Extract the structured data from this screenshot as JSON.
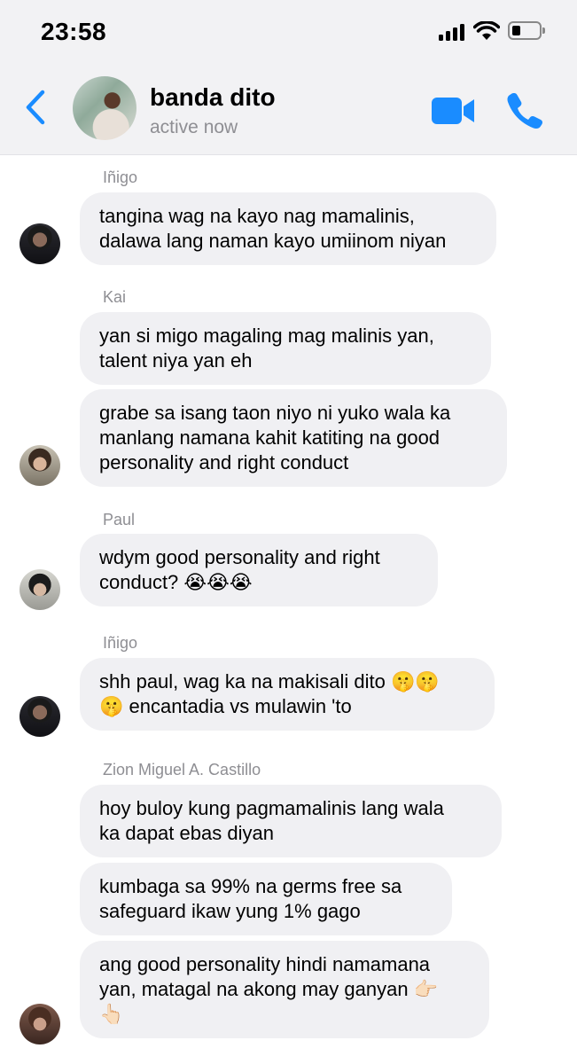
{
  "status_bar": {
    "time": "23:58"
  },
  "header": {
    "title": "banda dito",
    "status": "active now"
  },
  "messages": [
    {
      "sender": "Iñigo",
      "bubbles": [
        "tangina wag na kayo nag mamalinis,\ndalawa lang naman kayo umiinom niyan"
      ]
    },
    {
      "sender": "Kai",
      "bubbles": [
        "yan si migo magaling mag malinis yan,\ntalent niya yan eh",
        "grabe sa isang taon niyo ni yuko wala ka\nmanlang namana kahit katiting na good\npersonality and right conduct"
      ]
    },
    {
      "sender": "Paul",
      "bubbles": [
        "wdym good personality and right\nconduct? 😭😭😭"
      ]
    },
    {
      "sender": "Iñigo",
      "bubbles": [
        "shh paul, wag ka na makisali dito 🤫🤫\n🤫 encantadia vs mulawin 'to"
      ]
    },
    {
      "sender": "Zion Miguel A. Castillo",
      "bubbles": [
        "hoy buloy kung pagmamalinis lang wala\nka dapat ebas diyan",
        "kumbaga sa 99% na germs free sa\nsafeguard ikaw yung 1% gago",
        "ang good personality hindi namamana\nyan, matagal na akong may ganyan 👉🏻\n👆🏻"
      ]
    }
  ],
  "colors": {
    "accent": "#1a8cff",
    "bubble": "#f0f0f3",
    "header_bg": "#f2f2f4",
    "muted_text": "#8e8e93"
  }
}
